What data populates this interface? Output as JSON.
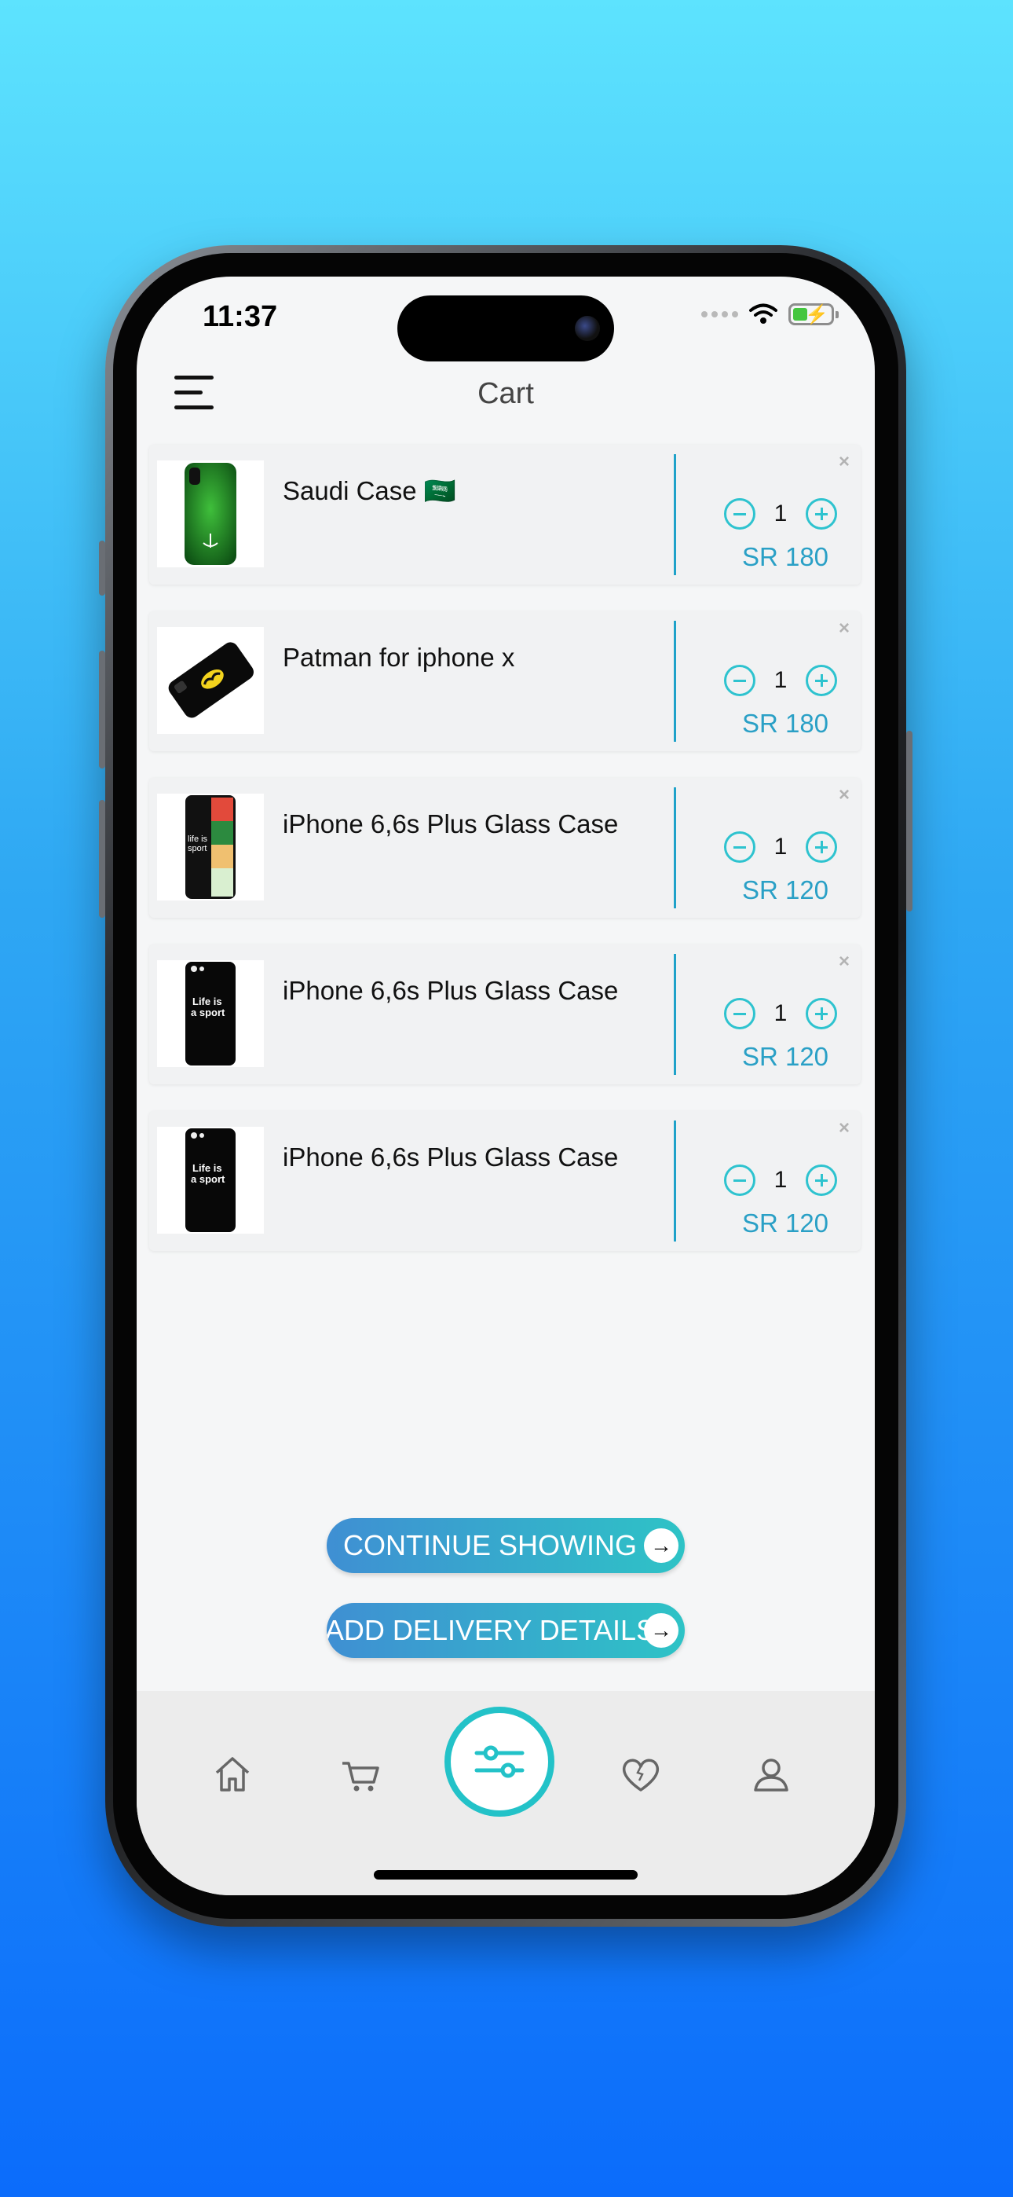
{
  "status_bar": {
    "time": "11:37"
  },
  "header": {
    "title": "Cart"
  },
  "cart_items": [
    {
      "name": "Saudi Case 🇸🇦",
      "quantity": "1",
      "price": "SR 180",
      "thumb": "green-phone-case"
    },
    {
      "name": "Patman for iphone x",
      "quantity": "1",
      "price": "SR 180",
      "thumb": "batman-phone-case"
    },
    {
      "name": "iPhone 6,6s Plus Glass Case",
      "quantity": "1",
      "price": "SR 120",
      "thumb": "collage-phone-case"
    },
    {
      "name": "iPhone 6,6s Plus Glass Case",
      "quantity": "1",
      "price": "SR 120",
      "thumb": "life-is-a-sport-case"
    },
    {
      "name": "iPhone 6,6s Plus Glass Case",
      "quantity": "1",
      "price": "SR 120",
      "thumb": "life-is-a-sport-case"
    }
  ],
  "remove_label": "×",
  "actions": {
    "continue_label": "CONTINUE SHOWING",
    "delivery_label": "ADD DELIVERY DETAILS",
    "arrow": "→"
  },
  "tabbar": {
    "tabs": [
      "home-icon",
      "cart-icon",
      "filter-icon",
      "heart-icon",
      "profile-icon"
    ],
    "active": "filter-icon"
  },
  "colors": {
    "accent": "#2ec3cf",
    "price": "#2aa0c6",
    "divider": "#1fa2c9"
  }
}
